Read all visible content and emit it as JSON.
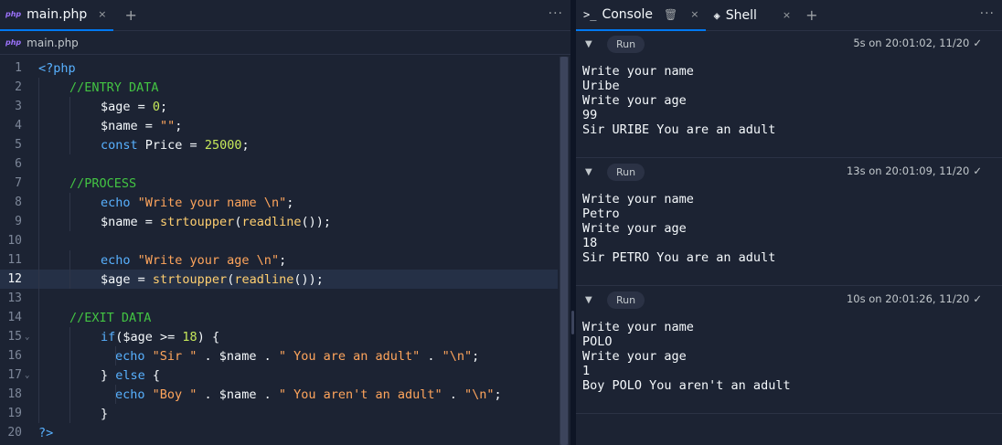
{
  "editor": {
    "tab_badge": "php",
    "tab_title": "main.php",
    "tab_close": "×",
    "tab_add": "+",
    "more": "···",
    "breadcrumb_badge": "php",
    "breadcrumb_file": "main.php",
    "lines": [
      {
        "n": "1",
        "indent": 0,
        "tokens": [
          [
            "kw",
            "<?php"
          ]
        ]
      },
      {
        "n": "2",
        "indent": 1,
        "tokens": [
          [
            "cm",
            "//ENTRY DATA"
          ]
        ]
      },
      {
        "n": "3",
        "indent": 2,
        "tokens": [
          [
            "va",
            "$age = "
          ],
          [
            "nm",
            "0"
          ],
          [
            "va",
            ";"
          ]
        ]
      },
      {
        "n": "4",
        "indent": 2,
        "tokens": [
          [
            "va",
            "$name = "
          ],
          [
            "st",
            "\"\""
          ],
          [
            "va",
            ";"
          ]
        ]
      },
      {
        "n": "5",
        "indent": 2,
        "tokens": [
          [
            "kw",
            "const "
          ],
          [
            "va",
            "Price = "
          ],
          [
            "nm",
            "25000"
          ],
          [
            "va",
            ";"
          ]
        ]
      },
      {
        "n": "6",
        "indent": 1,
        "tokens": []
      },
      {
        "n": "7",
        "indent": 1,
        "tokens": [
          [
            "cm",
            "//PROCESS"
          ]
        ]
      },
      {
        "n": "8",
        "indent": 2,
        "tokens": [
          [
            "kw",
            "echo "
          ],
          [
            "st",
            "\"Write your name \\n\""
          ],
          [
            "va",
            ";"
          ]
        ]
      },
      {
        "n": "9",
        "indent": 2,
        "tokens": [
          [
            "va",
            "$name = "
          ],
          [
            "fn",
            "strtoupper"
          ],
          [
            "va",
            "("
          ],
          [
            "fn",
            "readline"
          ],
          [
            "va",
            "());"
          ]
        ]
      },
      {
        "n": "10",
        "indent": 1,
        "tokens": []
      },
      {
        "n": "11",
        "indent": 2,
        "tokens": [
          [
            "kw",
            "echo "
          ],
          [
            "st",
            "\"Write your age \\n\""
          ],
          [
            "va",
            ";"
          ]
        ]
      },
      {
        "n": "12",
        "indent": 2,
        "active": true,
        "tokens": [
          [
            "va",
            "$age = "
          ],
          [
            "fn",
            "strtoupper"
          ],
          [
            "va",
            "("
          ],
          [
            "fn",
            "readline"
          ],
          [
            "va",
            "());"
          ]
        ]
      },
      {
        "n": "13",
        "indent": 1,
        "tokens": []
      },
      {
        "n": "14",
        "indent": 1,
        "tokens": [
          [
            "cm",
            "//EXIT DATA"
          ]
        ]
      },
      {
        "n": "15",
        "indent": 2,
        "fold": "⌄",
        "tokens": [
          [
            "kw",
            "if"
          ],
          [
            "va",
            "($age >= "
          ],
          [
            "nm",
            "18"
          ],
          [
            "va",
            ") {"
          ]
        ]
      },
      {
        "n": "16",
        "indent": 3,
        "tokens": [
          [
            "kw",
            "echo "
          ],
          [
            "st",
            "\"Sir \""
          ],
          [
            "va",
            " . $name . "
          ],
          [
            "st",
            "\" You are an adult\""
          ],
          [
            "va",
            " . "
          ],
          [
            "st",
            "\"\\n\""
          ],
          [
            "va",
            ";"
          ]
        ]
      },
      {
        "n": "17",
        "indent": 2,
        "fold": "⌄",
        "tokens": [
          [
            "va",
            "} "
          ],
          [
            "kw",
            "else"
          ],
          [
            "va",
            " {"
          ]
        ]
      },
      {
        "n": "18",
        "indent": 3,
        "tokens": [
          [
            "kw",
            "echo "
          ],
          [
            "st",
            "\"Boy \""
          ],
          [
            "va",
            " . $name . "
          ],
          [
            "st",
            "\" You aren't an adult\""
          ],
          [
            "va",
            " . "
          ],
          [
            "st",
            "\"\\n\""
          ],
          [
            "va",
            ";"
          ]
        ]
      },
      {
        "n": "19",
        "indent": 2,
        "tokens": [
          [
            "va",
            "}"
          ]
        ]
      },
      {
        "n": "20",
        "indent": 0,
        "tokens": [
          [
            "kw",
            "?>"
          ]
        ]
      }
    ]
  },
  "console": {
    "tab_console_icon": ">_",
    "tab_console": "Console",
    "tab_console_close": "×",
    "tab_shell_icon": "◈",
    "tab_shell": "Shell",
    "tab_shell_close": "×",
    "tab_add": "+",
    "more": "···",
    "runs": [
      {
        "label": "Run",
        "meta": "5s on 20:01:02, 11/20",
        "output": "Write your name\nUribe\nWrite your age\n99\nSir URIBE You are an adult"
      },
      {
        "label": "Run",
        "meta": "13s on 20:01:09, 11/20",
        "output": "Write your name\nPetro\nWrite your age\n18\nSir PETRO You are an adult"
      },
      {
        "label": "Run",
        "meta": "10s on 20:01:26, 11/20",
        "output": "Write your name\nPOLO\nWrite your age\n1\nBoy POLO You aren't an adult"
      }
    ]
  },
  "colors": {
    "keyword": "#58b1ff",
    "comment": "#43c443",
    "string": "#ffa55c",
    "number": "#c6e85a",
    "function": "#ffcf70",
    "accent": "#0079f2"
  }
}
